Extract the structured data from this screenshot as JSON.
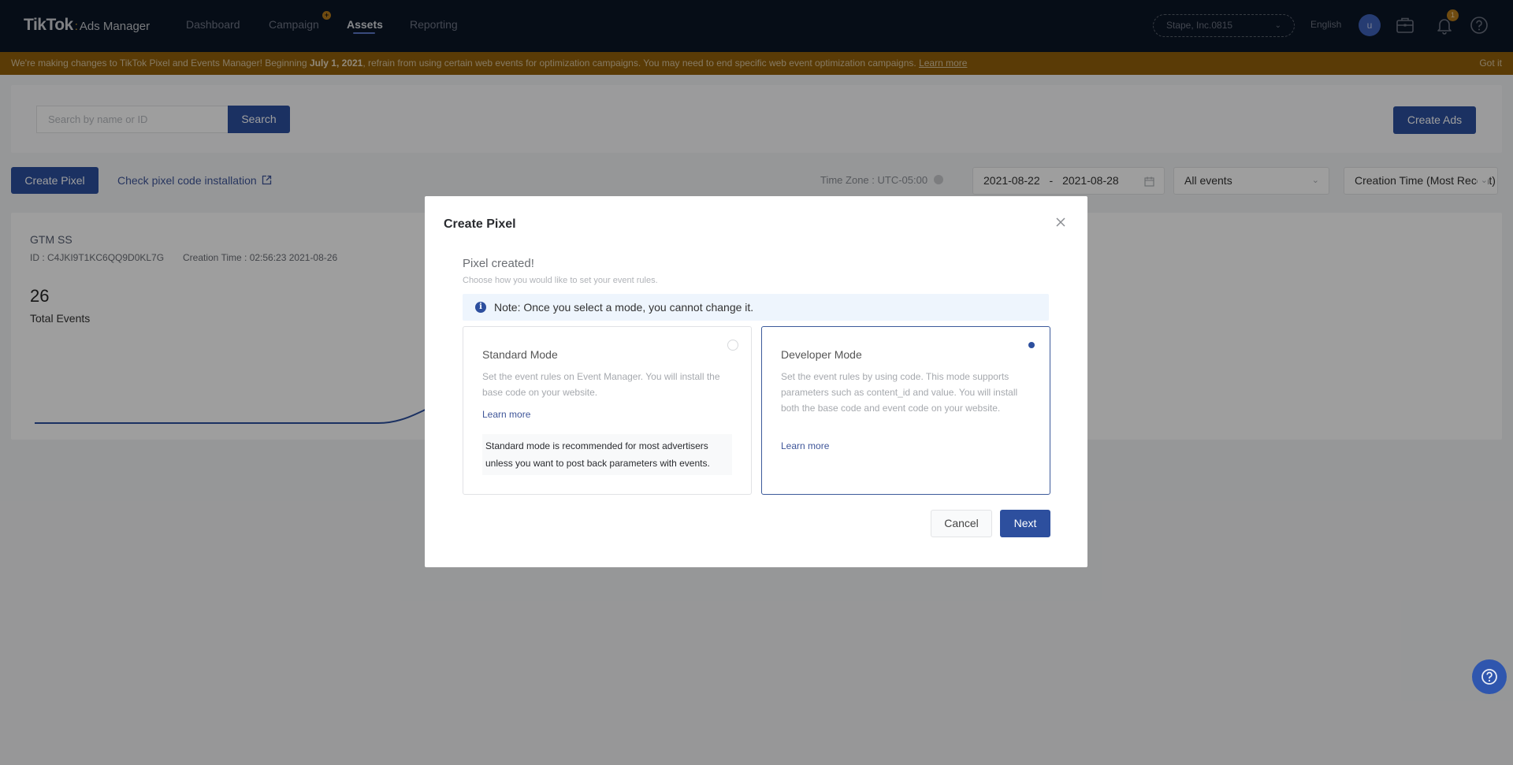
{
  "header": {
    "logo_main": "TikTok",
    "logo_sep": ":",
    "logo_sub": "Ads Manager",
    "nav": [
      {
        "label": "Dashboard",
        "active": false
      },
      {
        "label": "Campaign",
        "active": false,
        "badge": "+"
      },
      {
        "label": "Assets",
        "active": true
      },
      {
        "label": "Reporting",
        "active": false
      }
    ],
    "account": "Stape, Inc.0815",
    "language": "English",
    "avatar_initial": "u",
    "notification_count": "1",
    "icons": [
      "briefcase-icon",
      "bell-icon",
      "help-circle-icon"
    ]
  },
  "banner": {
    "text_before": "We're making changes to TikTok Pixel and Events Manager! Beginning ",
    "text_bold": "July 1, 2021",
    "text_after": ", refrain from using certain web events for optimization campaigns. You may need to end specific web event optimization campaigns. ",
    "link": "Learn more",
    "dismiss": "Got it",
    "color": "#92600a"
  },
  "toolbar": {
    "search_placeholder": "Search by name or ID",
    "search_button": "Search",
    "create_ads": "Create Ads",
    "create_pixel": "Create Pixel",
    "check_link": "Check pixel code installation",
    "timezone": "Time Zone : UTC-05:00",
    "date_start": "2021-08-22",
    "date_sep": "-",
    "date_end": "2021-08-28",
    "events_filter": "All events",
    "sort": "Creation Time (Most Recent)"
  },
  "pixel": {
    "name": "GTM SS",
    "id": "ID : C4JKI9T1KC6QQ9D0KL7G",
    "creation_time": "Creation Time : 02:56:23 2021-08-26",
    "total_events": "26",
    "total_events_label": "Total Events"
  },
  "modal": {
    "title": "Create Pixel",
    "heading": "Pixel created!",
    "subheading": "Choose how you would like to set your event rules.",
    "note": "Note: Once you select a mode, you cannot change it.",
    "modes": [
      {
        "title": "Standard Mode",
        "description": "Set the event rules on Event Manager. You will install the base code on your website.",
        "link": "Learn more",
        "recommendation": "Standard mode is recommended for most advertisers unless you want to post back parameters with events.",
        "selected": false
      },
      {
        "title": "Developer Mode",
        "description": "Set the event rules by using code. This mode supports parameters such as content_id and value. You will install both the base code and event code on your website.",
        "link": "Learn more",
        "selected": true
      }
    ],
    "cancel": "Cancel",
    "next": "Next",
    "accent": "#2d4f9e"
  }
}
